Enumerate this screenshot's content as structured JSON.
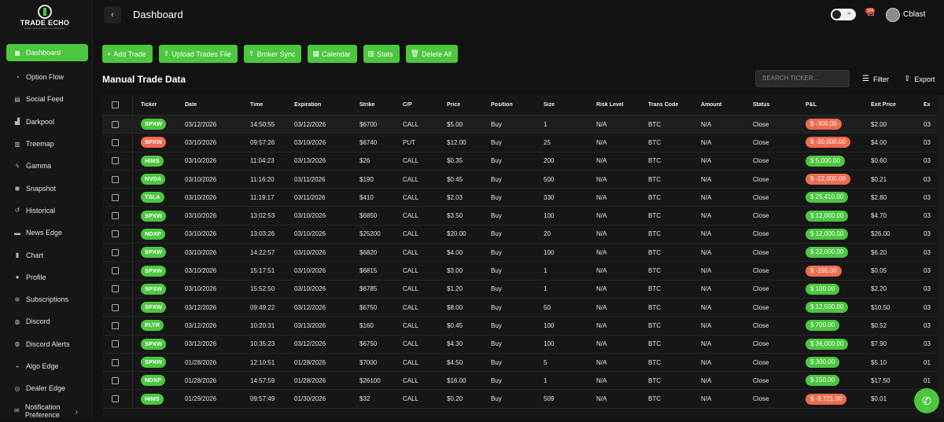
{
  "app": {
    "logo_text": "TRADE ECHO",
    "logo_sub": "SUPER TRADE EVENTS COMMUNITY"
  },
  "header": {
    "back_icon": "‹",
    "title": "Dashboard",
    "notification_count": "104",
    "username": "Cblast"
  },
  "sidebar": {
    "items": [
      {
        "label": "Dashboard",
        "icon": "▦"
      },
      {
        "label": "Option Flow",
        "icon": "◔"
      },
      {
        "label": "Social Feed",
        "icon": "▤"
      },
      {
        "label": "Darkpool",
        "icon": "▟"
      },
      {
        "label": "Treemap",
        "icon": "▥"
      },
      {
        "label": "Gamma",
        "icon": "ϟ"
      },
      {
        "label": "Snapshot",
        "icon": "◉"
      },
      {
        "label": "Historical",
        "icon": "↺"
      },
      {
        "label": "News Edge",
        "icon": "▬"
      },
      {
        "label": "Chart",
        "icon": "▮"
      },
      {
        "label": "Profile",
        "icon": "●"
      },
      {
        "label": "Subscriptions",
        "icon": "✲"
      },
      {
        "label": "Discord",
        "icon": "◍"
      },
      {
        "label": "Discord Alerts",
        "icon": "◍"
      },
      {
        "label": "Algo Edge",
        "icon": "⌁"
      },
      {
        "label": "Dealer Edge",
        "icon": "◎"
      },
      {
        "label": "Notification Preference",
        "icon": "✉"
      }
    ]
  },
  "actions": [
    {
      "label": "Add Trade",
      "icon": "+"
    },
    {
      "label": "Upload Trades File",
      "icon": "⇪"
    },
    {
      "label": "Broker Sync",
      "icon": "⇪"
    },
    {
      "label": "Calendar",
      "icon": "▦"
    },
    {
      "label": "Stats",
      "icon": "▥"
    },
    {
      "label": "Delete All",
      "icon": "🗑"
    }
  ],
  "section": {
    "title": "Manual Trade Data"
  },
  "search": {
    "placeholder": "SEARCH TICKER..."
  },
  "toolbar": {
    "filter_label": "Filter",
    "export_label": "Export"
  },
  "table": {
    "columns": [
      "Ticker",
      "Date",
      "Time",
      "Expiration",
      "Strike",
      "C/P",
      "Price",
      "Position",
      "Size",
      "Risk Level",
      "Trans Code",
      "Amount",
      "Status",
      "P&L",
      "Exit Price",
      "Ex"
    ],
    "rows": [
      {
        "ticker": "SPXW",
        "tc": "#4cc73f",
        "date": "03/12/2026",
        "time": "14:50:55",
        "exp": "03/12/2026",
        "strike": "$6700",
        "cp": "CALL",
        "price": "$5.00",
        "pos": "Buy",
        "size": "1",
        "risk": "N/A",
        "code": "BTC",
        "amount": "N/A",
        "status": "Close",
        "pl": "$ -300.00",
        "pl_neg": true,
        "exit": "$2.00",
        "more": "03"
      },
      {
        "ticker": "SPXW",
        "tc": "#f06b4f",
        "date": "03/10/2026",
        "time": "09:57:26",
        "exp": "03/10/2026",
        "strike": "$6740",
        "cp": "PUT",
        "price": "$12.00",
        "pos": "Buy",
        "size": "25",
        "risk": "N/A",
        "code": "BTC",
        "amount": "N/A",
        "status": "Close",
        "pl": "$ -20,000.00",
        "pl_neg": true,
        "exit": "$4.00",
        "more": "03"
      },
      {
        "ticker": "HIMS",
        "tc": "#4cc73f",
        "date": "03/10/2026",
        "time": "11:04:23",
        "exp": "03/13/2026",
        "strike": "$26",
        "cp": "CALL",
        "price": "$0.35",
        "pos": "Buy",
        "size": "200",
        "risk": "N/A",
        "code": "BTC",
        "amount": "N/A",
        "status": "Close",
        "pl": "$ 5,000.00",
        "pl_neg": false,
        "exit": "$0.60",
        "more": "03"
      },
      {
        "ticker": "NVDA",
        "tc": "#4cc73f",
        "date": "03/10/2026",
        "time": "11:16:20",
        "exp": "03/11/2026",
        "strike": "$190",
        "cp": "CALL",
        "price": "$0.45",
        "pos": "Buy",
        "size": "500",
        "risk": "N/A",
        "code": "BTC",
        "amount": "N/A",
        "status": "Close",
        "pl": "$ -12,000.00",
        "pl_neg": true,
        "exit": "$0.21",
        "more": "03"
      },
      {
        "ticker": "TSLA",
        "tc": "#4cc73f",
        "date": "03/10/2026",
        "time": "11:19:17",
        "exp": "03/11/2026",
        "strike": "$410",
        "cp": "CALL",
        "price": "$2.03",
        "pos": "Buy",
        "size": "330",
        "risk": "N/A",
        "code": "BTC",
        "amount": "N/A",
        "status": "Close",
        "pl": "$ 25,410.00",
        "pl_neg": false,
        "exit": "$2.80",
        "more": "03"
      },
      {
        "ticker": "SPXW",
        "tc": "#4cc73f",
        "date": "03/10/2026",
        "time": "13:02:53",
        "exp": "03/10/2026",
        "strike": "$6850",
        "cp": "CALL",
        "price": "$3.50",
        "pos": "Buy",
        "size": "100",
        "risk": "N/A",
        "code": "BTC",
        "amount": "N/A",
        "status": "Close",
        "pl": "$ 12,000.00",
        "pl_neg": false,
        "exit": "$4.70",
        "more": "03"
      },
      {
        "ticker": "NDXP",
        "tc": "#4cc73f",
        "date": "03/10/2026",
        "time": "13:03:26",
        "exp": "03/10/2026",
        "strike": "$25200",
        "cp": "CALL",
        "price": "$20.00",
        "pos": "Buy",
        "size": "20",
        "risk": "N/A",
        "code": "BTC",
        "amount": "N/A",
        "status": "Close",
        "pl": "$ 12,000.00",
        "pl_neg": false,
        "exit": "$26.00",
        "more": "03"
      },
      {
        "ticker": "SPXW",
        "tc": "#4cc73f",
        "date": "03/10/2026",
        "time": "14:22:57",
        "exp": "03/10/2026",
        "strike": "$6820",
        "cp": "CALL",
        "price": "$4.00",
        "pos": "Buy",
        "size": "100",
        "risk": "N/A",
        "code": "BTC",
        "amount": "N/A",
        "status": "Close",
        "pl": "$ 22,000.00",
        "pl_neg": false,
        "exit": "$6.20",
        "more": "03"
      },
      {
        "ticker": "SPXW",
        "tc": "#4cc73f",
        "date": "03/10/2026",
        "time": "15:17:51",
        "exp": "03/10/2026",
        "strike": "$6815",
        "cp": "CALL",
        "price": "$3.00",
        "pos": "Buy",
        "size": "1",
        "risk": "N/A",
        "code": "BTC",
        "amount": "N/A",
        "status": "Close",
        "pl": "$ -295.00",
        "pl_neg": true,
        "exit": "$0.05",
        "more": "03"
      },
      {
        "ticker": "SPXW",
        "tc": "#4cc73f",
        "date": "03/10/2026",
        "time": "15:52:50",
        "exp": "03/10/2026",
        "strike": "$6785",
        "cp": "CALL",
        "price": "$1.20",
        "pos": "Buy",
        "size": "1",
        "risk": "N/A",
        "code": "BTC",
        "amount": "N/A",
        "status": "Close",
        "pl": "$ 100.00",
        "pl_neg": false,
        "exit": "$2.20",
        "more": "03"
      },
      {
        "ticker": "SPXW",
        "tc": "#4cc73f",
        "date": "03/12/2026",
        "time": "09:49:22",
        "exp": "03/12/2026",
        "strike": "$6750",
        "cp": "CALL",
        "price": "$8.00",
        "pos": "Buy",
        "size": "50",
        "risk": "N/A",
        "code": "BTC",
        "amount": "N/A",
        "status": "Close",
        "pl": "$ 12,500.00",
        "pl_neg": false,
        "exit": "$10.50",
        "more": "03"
      },
      {
        "ticker": "PLTR",
        "tc": "#4cc73f",
        "date": "03/12/2026",
        "time": "10:20:31",
        "exp": "03/13/2026",
        "strike": "$160",
        "cp": "CALL",
        "price": "$0.45",
        "pos": "Buy",
        "size": "100",
        "risk": "N/A",
        "code": "BTC",
        "amount": "N/A",
        "status": "Close",
        "pl": "$ 700.00",
        "pl_neg": false,
        "exit": "$0.52",
        "more": "03"
      },
      {
        "ticker": "SPXW",
        "tc": "#4cc73f",
        "date": "03/12/2026",
        "time": "10:35:23",
        "exp": "03/12/2026",
        "strike": "$6750",
        "cp": "CALL",
        "price": "$4.30",
        "pos": "Buy",
        "size": "100",
        "risk": "N/A",
        "code": "BTC",
        "amount": "N/A",
        "status": "Close",
        "pl": "$ 36,000.00",
        "pl_neg": false,
        "exit": "$7.90",
        "more": "03"
      },
      {
        "ticker": "SPXW",
        "tc": "#4cc73f",
        "date": "01/28/2026",
        "time": "12:10:51",
        "exp": "01/28/2026",
        "strike": "$7000",
        "cp": "CALL",
        "price": "$4.50",
        "pos": "Buy",
        "size": "5",
        "risk": "N/A",
        "code": "BTC",
        "amount": "N/A",
        "status": "Close",
        "pl": "$ 300.00",
        "pl_neg": false,
        "exit": "$5.10",
        "more": "01"
      },
      {
        "ticker": "NDXP",
        "tc": "#4cc73f",
        "date": "01/28/2026",
        "time": "14:57:59",
        "exp": "01/28/2026",
        "strike": "$26100",
        "cp": "CALL",
        "price": "$16.00",
        "pos": "Buy",
        "size": "1",
        "risk": "N/A",
        "code": "BTC",
        "amount": "N/A",
        "status": "Close",
        "pl": "$ 150.00",
        "pl_neg": false,
        "exit": "$17.50",
        "more": "01"
      },
      {
        "ticker": "HIMS",
        "tc": "#4cc73f",
        "date": "01/29/2026",
        "time": "09:57:49",
        "exp": "01/30/2026",
        "strike": "$32",
        "cp": "CALL",
        "price": "$0.20",
        "pos": "Buy",
        "size": "509",
        "risk": "N/A",
        "code": "BTC",
        "amount": "N/A",
        "status": "Close",
        "pl": "$ -9,721.00",
        "pl_neg": true,
        "exit": "$0.01",
        "more": "01"
      }
    ]
  }
}
